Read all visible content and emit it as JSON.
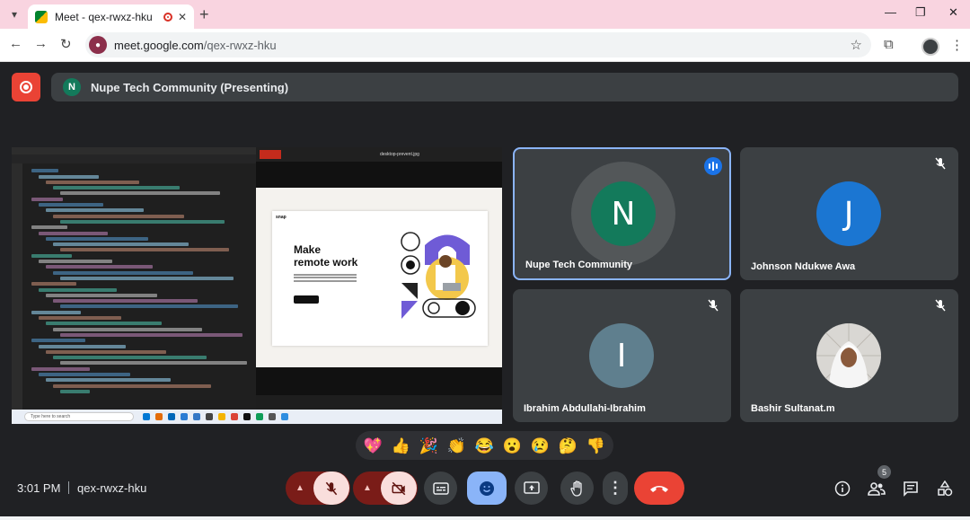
{
  "browser": {
    "tab_title": "Meet - qex-rwxz-hku",
    "url_host": "meet.google.com",
    "url_path": "/qex-rwxz-hku",
    "newtab_label": "+",
    "tab_close": "✕",
    "min_label": "—",
    "restore_label": "❐",
    "close_label": "✕"
  },
  "meet": {
    "presenting_initial": "N",
    "presenting_text": "Nupe Tech Community (Presenting)",
    "participants": [
      {
        "name": "Nupe Tech Community",
        "initial": "N",
        "color": "#137a5b",
        "state": "speaking"
      },
      {
        "name": "Johnson Ndukwe Awa",
        "initial": "J",
        "color": "#1b76d2",
        "state": "muted"
      },
      {
        "name": "Ibrahim Abdullahi-Ibrahim",
        "initial": "I",
        "color": "#5f7f8e",
        "state": "muted"
      },
      {
        "name": "Bashir Sultanat.m",
        "initial": "",
        "color": "#e8e6e3",
        "state": "muted"
      }
    ],
    "reactions": [
      "💖",
      "👍",
      "🎉",
      "👏",
      "😂",
      "😮",
      "😢",
      "🤔",
      "👎"
    ],
    "time": "3:01 PM",
    "meeting_code": "qex-rwxz-hku",
    "participant_count": "5"
  },
  "shared_screen": {
    "viewer_title": "desktop-prevent.jpg",
    "snap_logo": "snap",
    "headline_line1": "Make",
    "headline_line2": "remote work",
    "taskbar_search": "Type here to search"
  },
  "icons": {
    "record": "record-icon",
    "mic": "mic-off-icon",
    "cam": "camera-off-icon",
    "captions": "captions-icon",
    "emoji": "emoji-icon",
    "present": "present-icon",
    "hand": "raise-hand-icon",
    "more": "more-vert-icon",
    "hangup": "hangup-icon",
    "info": "info-icon",
    "people": "people-icon",
    "chat": "chat-icon",
    "activities": "activities-icon"
  },
  "colors": {
    "accent": "#8ab4f8",
    "danger": "#ea4335",
    "surface": "#3c4043",
    "background": "#202124"
  }
}
